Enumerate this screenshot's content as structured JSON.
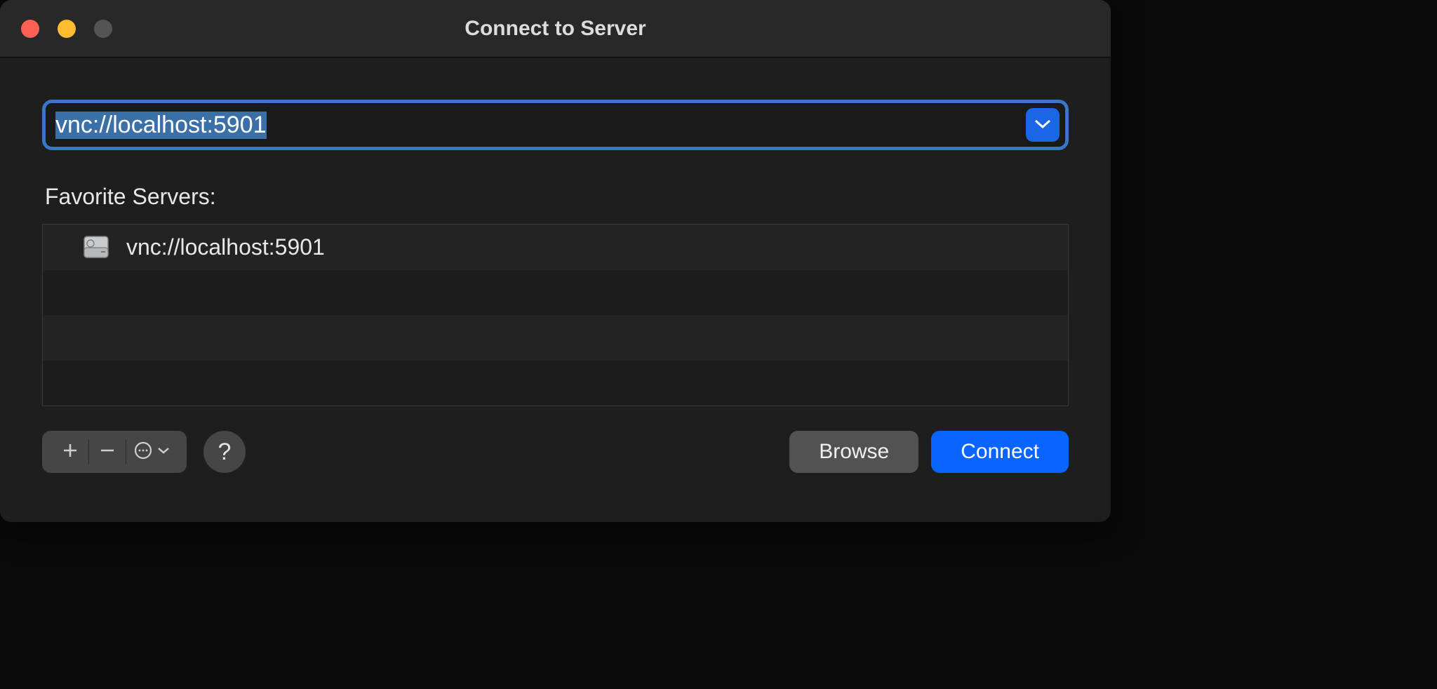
{
  "window": {
    "title": "Connect to Server"
  },
  "address": {
    "value": "vnc://localhost:5901"
  },
  "favorites": {
    "label": "Favorite Servers:",
    "items": [
      {
        "url": "vnc://localhost:5901"
      }
    ]
  },
  "buttons": {
    "browse": "Browse",
    "connect": "Connect",
    "help": "?"
  }
}
